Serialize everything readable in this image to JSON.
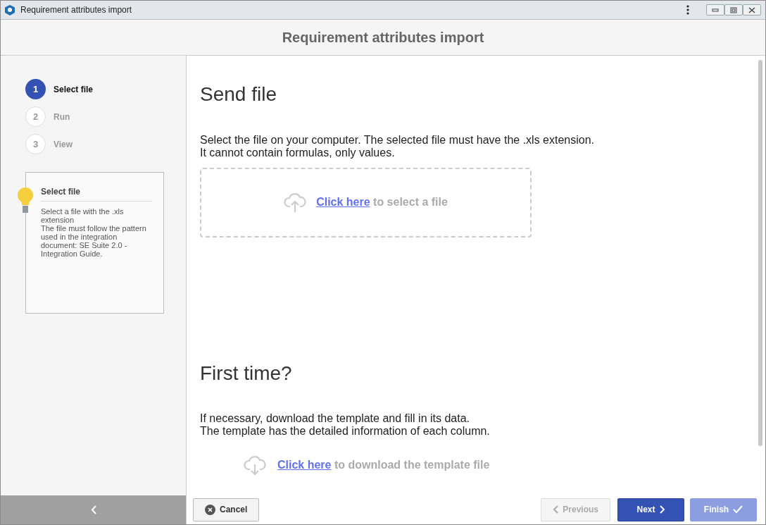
{
  "window": {
    "title": "Requirement attributes import"
  },
  "header": {
    "title": "Requirement attributes import"
  },
  "steps": [
    {
      "number": "1",
      "label": "Select file",
      "selected": true
    },
    {
      "number": "2",
      "label": "Run",
      "selected": false
    },
    {
      "number": "3",
      "label": "View",
      "selected": false
    }
  ],
  "tip": {
    "title": "Select file",
    "lines": [
      "Select a file with the .xls extension",
      "The file must follow the pattern used in the integration document: SE Suite 2.0 - Integration Guide."
    ]
  },
  "sections": [
    {
      "kind": "upload",
      "title": "Send file",
      "lines": [
        "Select the file on your computer. The selected file must have the .xls extension.",
        "It cannot contain formulas, only values."
      ],
      "link": "Click here",
      "link_rest": " to select a file"
    },
    {
      "kind": "download",
      "title": "First time?",
      "lines": [
        "If necessary, download the template and fill in its data.",
        "The template has the detailed information of each column."
      ],
      "link": "Click here",
      "link_rest": " to download the template file"
    }
  ],
  "buttons": [
    {
      "kind": "cancel",
      "label": "Cancel",
      "disabled": false
    },
    {
      "kind": "previous",
      "label": "Previous",
      "disabled": true
    },
    {
      "kind": "next",
      "label": "Next",
      "disabled": false
    },
    {
      "kind": "finish",
      "label": "Finish",
      "disabled": true
    }
  ]
}
